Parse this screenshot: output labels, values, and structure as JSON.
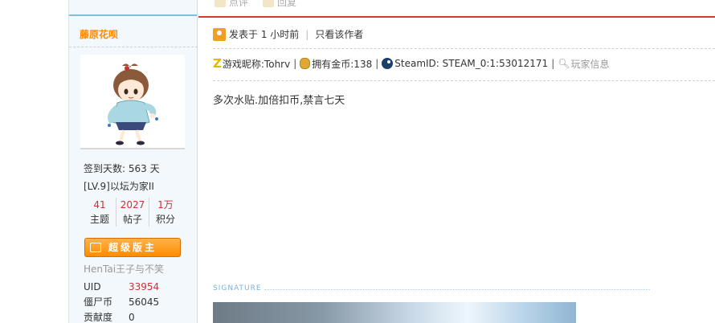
{
  "user": {
    "name": "藤原花呗",
    "sign_days": "签到天数: 563 天",
    "level": "[LV.9]以坛为家II",
    "counts": [
      {
        "value": "41",
        "label": "主题"
      },
      {
        "value": "2027",
        "label": "帖子"
      },
      {
        "value": "1万",
        "label": "积分"
      }
    ],
    "badge": "超级版主",
    "custom_title": "HenTai王子与不笑",
    "info": [
      {
        "key": "UID",
        "value": "33954"
      },
      {
        "key": "僵尸币",
        "value": "56045"
      },
      {
        "key": "贡献度",
        "value": "0"
      }
    ]
  },
  "prev_actions": [
    "点评",
    "回复"
  ],
  "post": {
    "posted": "发表于 1 小时前",
    "only_author": "只看该作者",
    "game_nick": "游戏昵称:Tohrv",
    "coins": "拥有金币:138",
    "steam_id": "SteamID: STEAM_0:1:53012171",
    "player_info": "玩家信息",
    "message": "多次水贴.加倍扣币,禁言七天",
    "signature_label": "SIGNATURE"
  }
}
